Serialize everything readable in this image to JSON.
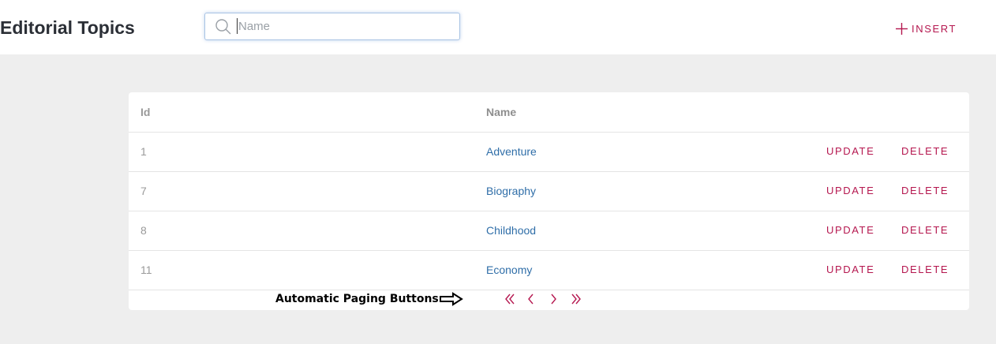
{
  "header": {
    "title": "Editorial Topics",
    "search_placeholder": "Name",
    "insert_label": "INSERT"
  },
  "table": {
    "columns": [
      "Id",
      "Name"
    ],
    "rows": [
      {
        "id": "1",
        "name": "Adventure"
      },
      {
        "id": "7",
        "name": "Biography"
      },
      {
        "id": "8",
        "name": "Childhood"
      },
      {
        "id": "11",
        "name": "Economy"
      }
    ],
    "update_label": "UPDATE",
    "delete_label": "DELETE"
  },
  "pager": {
    "annotation": "Automatic Paging Buttons",
    "buttons": [
      "first-page",
      "previous-page",
      "next-page",
      "last-page"
    ]
  },
  "colors": {
    "accent": "#b5174f",
    "link": "#2f6ea8",
    "background": "#eeeeee"
  }
}
